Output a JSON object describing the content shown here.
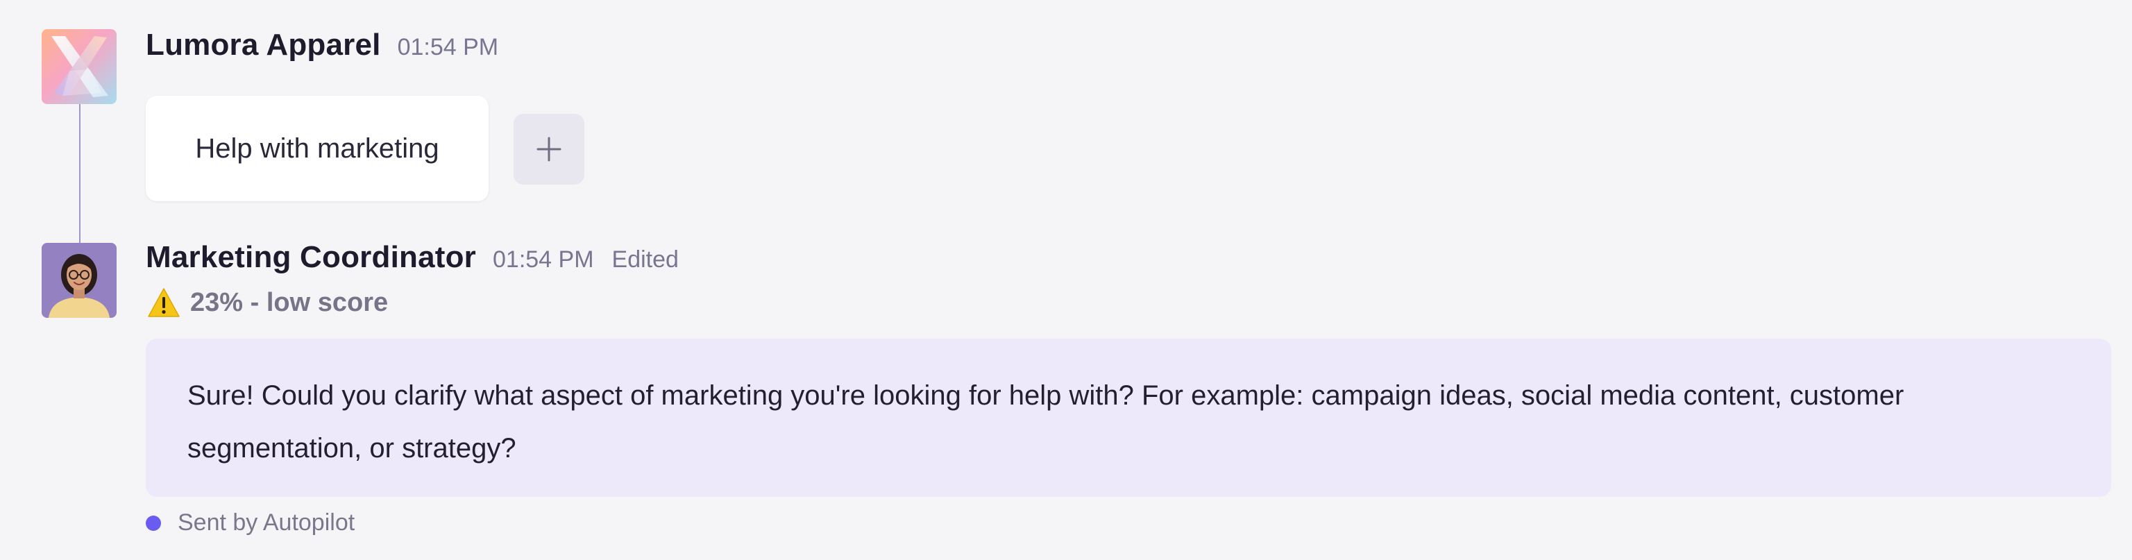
{
  "messages": [
    {
      "sender": "Lumora Apparel",
      "time": "01:54 PM",
      "avatar_icon": "lumora-logo-icon",
      "text": "Help with marketing",
      "add_button_icon": "plus-icon"
    },
    {
      "sender": "Marketing Coordinator",
      "time": "01:54 PM",
      "edited_label": "Edited",
      "avatar_icon": "person-avatar",
      "score": {
        "icon": "warning-icon",
        "label": "23% - low score",
        "value_percent": 23
      },
      "text": "Sure! Could you clarify what aspect of marketing you're looking for help with? For example: campaign ideas, social media content, customer segmentation, or strategy?",
      "status_label": "Sent by Autopilot"
    }
  ],
  "colors": {
    "background": "#f5f5f8",
    "bot_bubble": "#ede9fb",
    "user_bubble": "#ffffff",
    "accent": "#6a5cf0",
    "connector": "#9e97c3",
    "warning": "#f5c518"
  }
}
